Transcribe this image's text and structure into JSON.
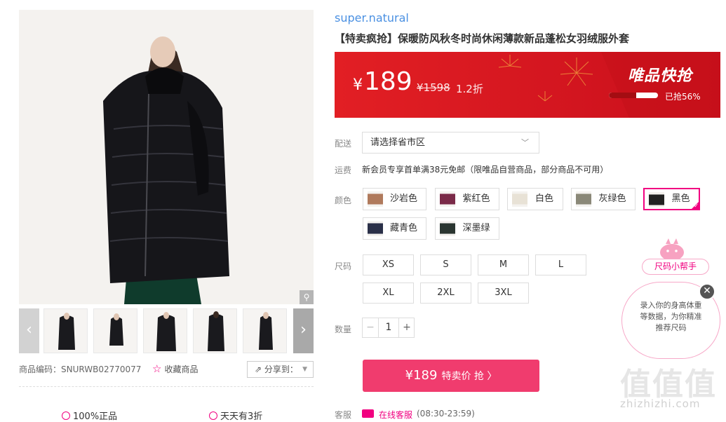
{
  "product": {
    "brand": "super.natural",
    "title": "【特卖疯抢】保暖防风秋冬时尚休闲薄款新品蓬松女羽绒服外套",
    "sku_code": "商品编码：SNURWB02770077",
    "favorite_label": "收藏商品",
    "share_label": "分享到："
  },
  "banner": {
    "currency": "¥",
    "price": "189",
    "original_price": "¥1598",
    "discount": "1.2折",
    "tag": "唯品快抢",
    "sold_text": "已抢56%",
    "progress": 0.56,
    "colors": {
      "start": "#e21f24",
      "end": "#c90f1c"
    }
  },
  "delivery": {
    "label": "配送",
    "region_placeholder": "请选择省市区"
  },
  "freight": {
    "label": "运费",
    "text": "新会员专享首单满38元免邮（限唯品自营商品，部分商品不可用）"
  },
  "colors": {
    "label": "颜色",
    "options": [
      {
        "name": "沙岩色",
        "swatch": "#b07a5c"
      },
      {
        "name": "紫红色",
        "swatch": "#7a2a48"
      },
      {
        "name": "白色",
        "swatch": "#e8e2d6"
      },
      {
        "name": "灰绿色",
        "swatch": "#8a8878"
      },
      {
        "name": "黑色",
        "swatch": "#222222"
      },
      {
        "name": "藏青色",
        "swatch": "#2a3048"
      },
      {
        "name": "深墨绿",
        "swatch": "#2a3530"
      }
    ],
    "selected": "黑色"
  },
  "sizes": {
    "label": "尺码",
    "options": [
      "XS",
      "S",
      "M",
      "L",
      "XL",
      "2XL",
      "3XL"
    ]
  },
  "quantity": {
    "label": "数量",
    "value": "1",
    "minus": "−",
    "plus": "+"
  },
  "buy": {
    "price": "¥189",
    "label": "特卖价 抢 〉"
  },
  "service": {
    "label": "客服",
    "link": "在线客服",
    "hours": "(08:30-23:59)"
  },
  "guarantees": [
    "100%正品",
    "天天有3折"
  ],
  "size_helper": {
    "tag": "尺码小帮手",
    "text": "录入你的身高体重等数据，为你精准推荐尺码",
    "close": "✕"
  },
  "watermark": {
    "logo": "值值值",
    "url": "zhizhizhi.com"
  },
  "icons": {
    "zoom": "search-icon",
    "prev": "chevron-left-icon",
    "next": "chevron-right-icon",
    "star": "star-icon",
    "share": "share-icon"
  },
  "accent_color": "#f10180"
}
